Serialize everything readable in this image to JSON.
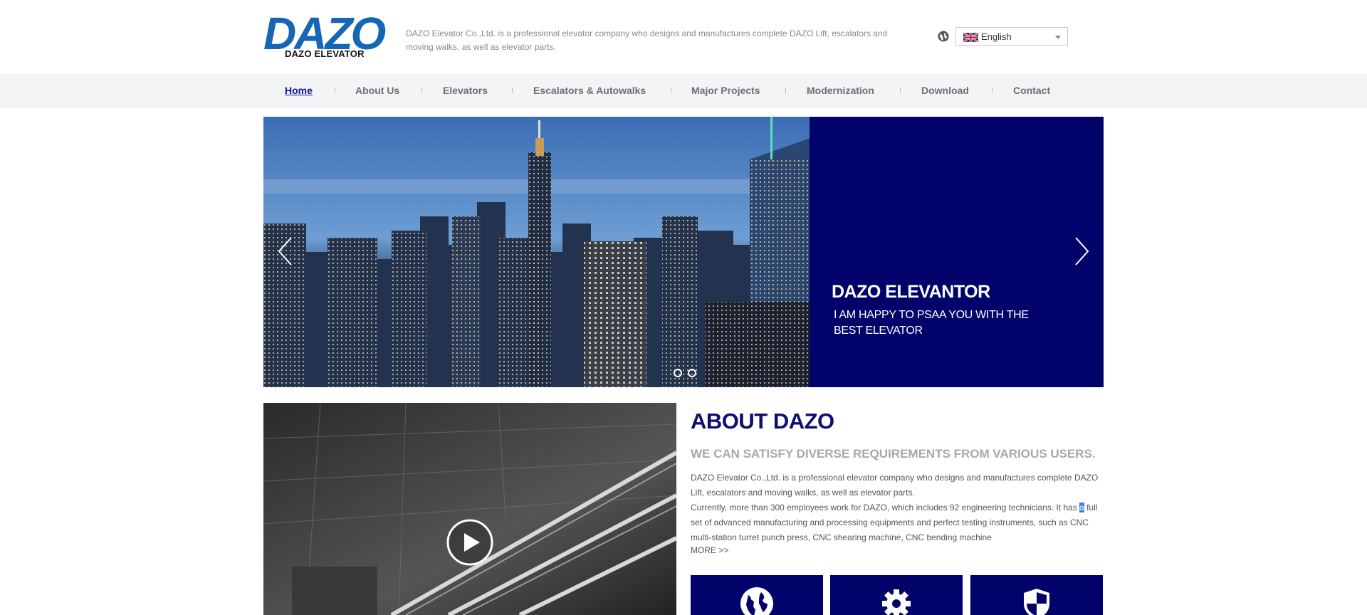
{
  "header": {
    "logo_text": "DAZO",
    "logo_subtext": "DAZO ELEVATOR",
    "tagline": "DAZO Elevator Co.,Ltd. is a professional elevator company who designs and manufactures complete DAZO Lift, escalators and moving walks, as well as elevator parts.",
    "language": {
      "selected": "English",
      "icon": "uk-flag-icon"
    }
  },
  "nav": {
    "items": [
      {
        "label": "Home",
        "active": true
      },
      {
        "label": "About Us"
      },
      {
        "label": "Elevators"
      },
      {
        "label": "Escalators & Autowalks"
      },
      {
        "label": "Major Projects"
      },
      {
        "label": "Modernization"
      },
      {
        "label": "Download"
      },
      {
        "label": "Contact"
      }
    ]
  },
  "hero": {
    "title": "DAZO ELEVANTOR",
    "subtitle": "I AM HAPPY TO PSAA YOU WITH THE BEST ELEVATOR",
    "slide_count": 2,
    "accent_color": "#01036b"
  },
  "about": {
    "title": "ABOUT DAZO",
    "subtitle": "WE CAN SATISFY DIVERSE REQUIREMENTS FROM VARIOUS USERS.",
    "para1": "DAZO Elevator Co.,Ltd. is a professional elevator company who designs and manufactures complete DAZO Lift, escalators and moving walks, as well as elevator parts.",
    "para2_before": "Currently, more than 300 employees work for DAZO, which includes 92 engineering technicians. It has ",
    "para2_highlight": "a",
    "para2_after": " full set of advanced manufacturing and processing equipments and perfect testing instruments, such as CNC multi-station turret punch press, CNC shearing machine, CNC bending machine",
    "more": "MORE >>"
  },
  "features": [
    {
      "icon": "globe-icon"
    },
    {
      "icon": "gear-icon"
    },
    {
      "icon": "shield-icon"
    }
  ]
}
